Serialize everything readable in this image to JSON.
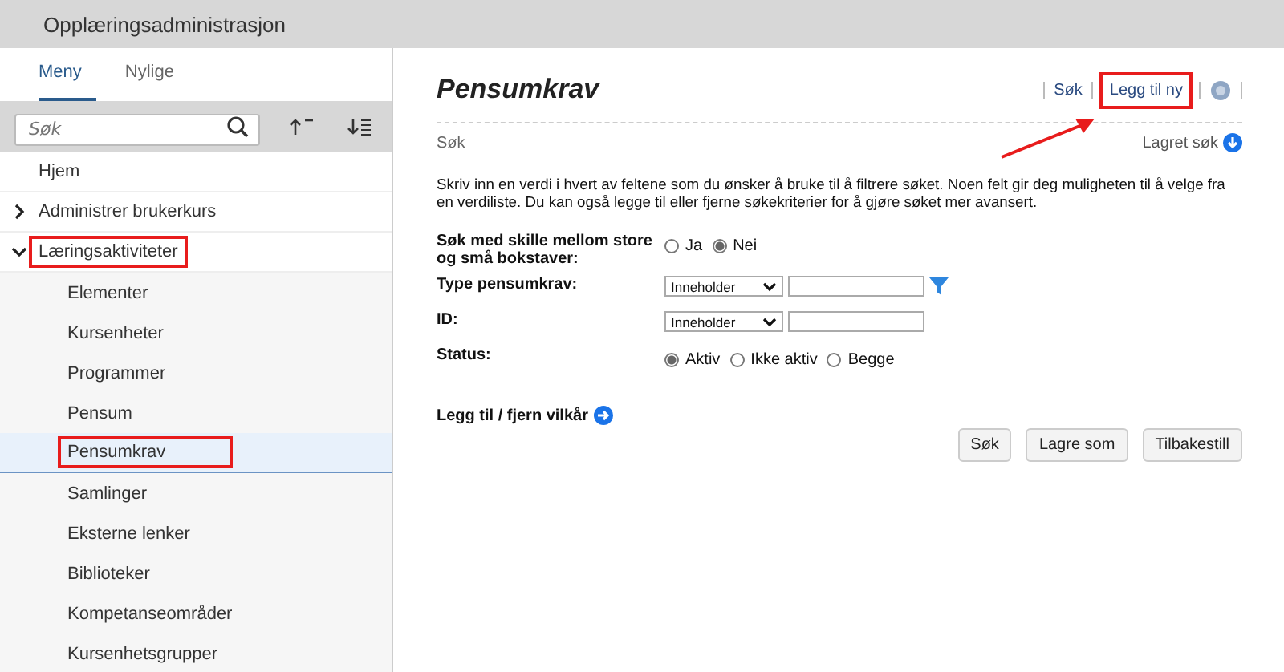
{
  "header": {
    "title": "Opplæringsadministrasjon"
  },
  "sidebar": {
    "tabs": [
      {
        "label": "Meny",
        "selected": true
      },
      {
        "label": "Nylige",
        "selected": false
      }
    ],
    "search": {
      "placeholder": "Søk"
    },
    "items": [
      {
        "label": "Hjem",
        "selected": false,
        "highlighted": false
      },
      {
        "label": "Administrer brukerkurs",
        "selected": false,
        "highlighted": false,
        "expanded": false
      },
      {
        "label": "Læringsaktiviteter",
        "selected": false,
        "highlighted": true,
        "expanded": true,
        "children": [
          {
            "label": "Elementer",
            "selected": false,
            "highlighted": false
          },
          {
            "label": "Kursenheter",
            "selected": false,
            "highlighted": false
          },
          {
            "label": "Programmer",
            "selected": false,
            "highlighted": false
          },
          {
            "label": "Pensum",
            "selected": false,
            "highlighted": false
          },
          {
            "label": "Pensumkrav",
            "selected": true,
            "highlighted": true
          },
          {
            "label": "Samlinger",
            "selected": false,
            "highlighted": false
          },
          {
            "label": "Eksterne lenker",
            "selected": false,
            "highlighted": false
          },
          {
            "label": "Biblioteker",
            "selected": false,
            "highlighted": false
          },
          {
            "label": "Kompetanseområder",
            "selected": false,
            "highlighted": false
          },
          {
            "label": "Kursenhetsgrupper",
            "selected": false,
            "highlighted": false
          }
        ]
      }
    ]
  },
  "main": {
    "title": "Pensumkrav",
    "links": [
      {
        "label": "Søk",
        "highlighted": false
      },
      {
        "label": "Legg til ny",
        "highlighted": true
      }
    ],
    "section": "Søk",
    "saved_search": "Lagret søk",
    "intro": "Skriv inn en verdi i hvert av feltene som du ønsker å bruke til å filtrere søket. Noen felt gir deg muligheten til å velge fra en verdiliste. Du kan også legge til eller fjerne søkekriterier for å gjøre søket mer avansert.",
    "fields": [
      {
        "kind": "radio",
        "label": "Søk med skille mellom store og små bokstaver:",
        "options": [
          {
            "label": "Ja",
            "selected": false
          },
          {
            "label": "Nei",
            "selected": true
          }
        ]
      },
      {
        "kind": "text",
        "label": "Type pensumkrav:",
        "operator": "Inneholder",
        "filter": true
      },
      {
        "kind": "text",
        "label": "ID:",
        "operator": "Inneholder"
      },
      {
        "kind": "radio",
        "label": "Status:",
        "options": [
          {
            "label": "Aktiv",
            "selected": true
          },
          {
            "label": "Ikke aktiv",
            "selected": false
          },
          {
            "label": "Begge",
            "selected": false
          }
        ]
      }
    ],
    "conditions": "Legg til / fjern vilkår",
    "buttons": [
      "Søk",
      "Lagre som",
      "Tilbakestill"
    ]
  }
}
